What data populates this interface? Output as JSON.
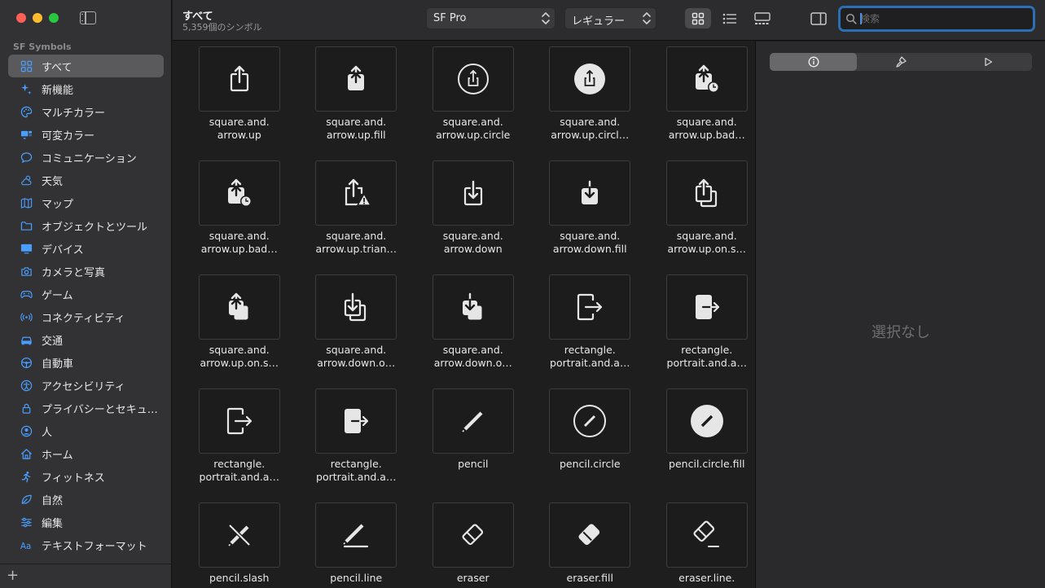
{
  "sidebar": {
    "section_title": "SF Symbols",
    "items": [
      {
        "label": "すべて",
        "icon": "grid-icon",
        "selected": true
      },
      {
        "label": "新機能",
        "icon": "sparkle-icon"
      },
      {
        "label": "マルチカラー",
        "icon": "palette-icon"
      },
      {
        "label": "可変カラー",
        "icon": "variable-color-icon"
      },
      {
        "label": "コミュニケーション",
        "icon": "message-icon"
      },
      {
        "label": "天気",
        "icon": "cloud-sun-icon"
      },
      {
        "label": "マップ",
        "icon": "map-icon"
      },
      {
        "label": "オブジェクトとツール",
        "icon": "folder-icon"
      },
      {
        "label": "デバイス",
        "icon": "display-icon"
      },
      {
        "label": "カメラと写真",
        "icon": "camera-icon"
      },
      {
        "label": "ゲーム",
        "icon": "gamecontroller-icon"
      },
      {
        "label": "コネクティビティ",
        "icon": "antenna-icon"
      },
      {
        "label": "交通",
        "icon": "car-icon"
      },
      {
        "label": "自動車",
        "icon": "steering-wheel-icon"
      },
      {
        "label": "アクセシビリティ",
        "icon": "accessibility-icon"
      },
      {
        "label": "プライバシーとセキュ…",
        "icon": "lock-icon"
      },
      {
        "label": "人",
        "icon": "person-icon"
      },
      {
        "label": "ホーム",
        "icon": "house-icon"
      },
      {
        "label": "フィットネス",
        "icon": "figure-run-icon"
      },
      {
        "label": "自然",
        "icon": "leaf-icon"
      },
      {
        "label": "編集",
        "icon": "slider-icon"
      },
      {
        "label": "テキストフォーマット",
        "icon": "textformat-icon"
      }
    ],
    "add_label": "+"
  },
  "toolbar": {
    "title": "すべて",
    "subtitle": "5,359個のシンボル",
    "font_popup": "SF Pro",
    "weight_popup": "レギュラー",
    "search_placeholder": "検索",
    "view_modes": [
      "grid-view-icon",
      "list-view-icon",
      "gallery-view-icon"
    ],
    "active_view": "grid-view-icon"
  },
  "symbols": [
    {
      "label": "square.and.\narrow.up",
      "icon": "square-and-arrow-up"
    },
    {
      "label": "square.and.\narrow.up.fill",
      "icon": "square-and-arrow-up-fill"
    },
    {
      "label": "square.and.\narrow.up.circle",
      "icon": "square-and-arrow-up-circle"
    },
    {
      "label": "square.and.\narrow.up.circl…",
      "icon": "square-and-arrow-up-circle-fill"
    },
    {
      "label": "square.and.\narrow.up.bad…",
      "icon": "square-and-arrow-up-badge-clock"
    },
    {
      "label": "square.and.\narrow.up.bad…",
      "icon": "square-and-arrow-up-badge-clock-fill"
    },
    {
      "label": "square.and.\narrow.up.trian…",
      "icon": "square-and-arrow-up-trianglebadge"
    },
    {
      "label": "square.and.\narrow.down",
      "icon": "square-and-arrow-down"
    },
    {
      "label": "square.and.\narrow.down.fill",
      "icon": "square-and-arrow-down-fill"
    },
    {
      "label": "square.and.\narrow.up.on.s…",
      "icon": "square-and-arrow-up-on-square"
    },
    {
      "label": "square.and.\narrow.up.on.s…",
      "icon": "square-and-arrow-up-on-square-fill"
    },
    {
      "label": "square.and.\narrow.down.o…",
      "icon": "square-and-arrow-down-on-square"
    },
    {
      "label": "square.and.\narrow.down.o…",
      "icon": "square-and-arrow-down-on-square-fill"
    },
    {
      "label": "rectangle.\nportrait.and.a…",
      "icon": "rectangle-portrait-and-arrow-right"
    },
    {
      "label": "rectangle.\nportrait.and.a…",
      "icon": "rectangle-portrait-and-arrow-right-fill"
    },
    {
      "label": "rectangle.\nportrait.and.a…",
      "icon": "rectangle-portrait-and-arrow-forward"
    },
    {
      "label": "rectangle.\nportrait.and.a…",
      "icon": "rectangle-portrait-and-arrow-forward-fill"
    },
    {
      "label": "pencil",
      "icon": "pencil"
    },
    {
      "label": "pencil.circle",
      "icon": "pencil-circle"
    },
    {
      "label": "pencil.circle.fill",
      "icon": "pencil-circle-fill"
    },
    {
      "label": "pencil.slash",
      "icon": "pencil-slash"
    },
    {
      "label": "pencil.line",
      "icon": "pencil-line"
    },
    {
      "label": "eraser",
      "icon": "eraser"
    },
    {
      "label": "eraser.fill",
      "icon": "eraser-fill"
    },
    {
      "label": "eraser.line.",
      "icon": "eraser-line-dashed"
    }
  ],
  "inspector": {
    "tabs": [
      "info-icon",
      "paintbrush-icon",
      "play-icon"
    ],
    "active_tab": "info-icon",
    "empty_text": "選択なし"
  },
  "colors": {
    "accent": "#2a6fb4",
    "sidebar_icon": "#4a9eff",
    "selection": "#5a5a5d"
  }
}
